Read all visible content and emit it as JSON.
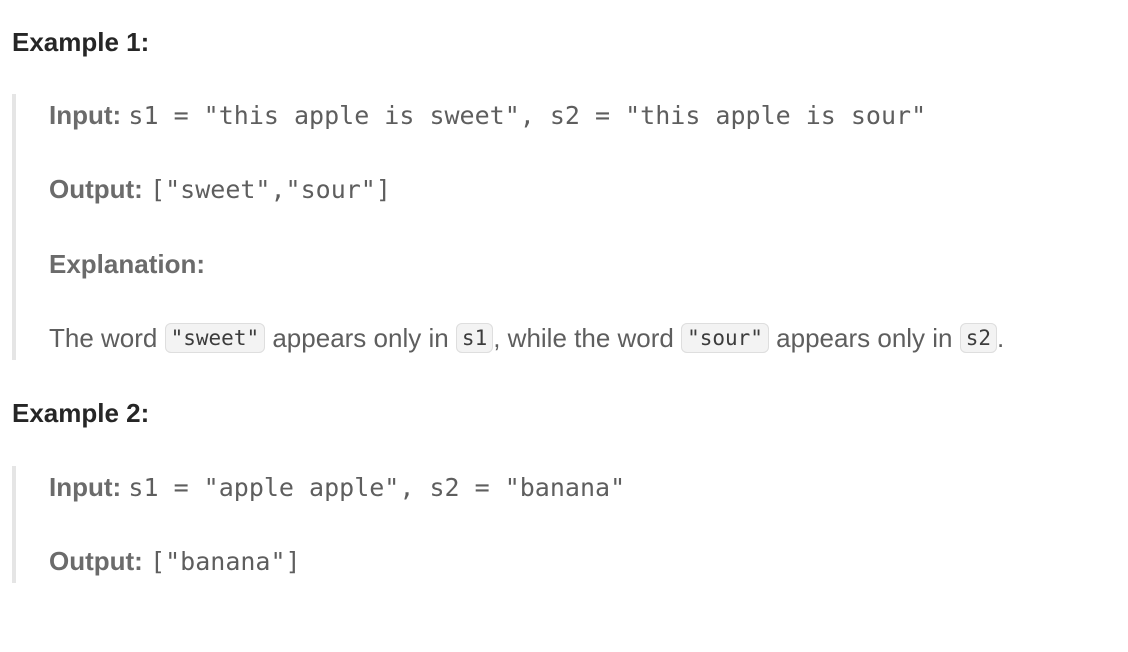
{
  "example1": {
    "heading": "Example 1:",
    "input_label": "Input:",
    "input_value": "s1 = \"this apple is sweet\", s2 = \"this apple is sour\"",
    "output_label": "Output:",
    "output_value": "[\"sweet\",\"sour\"]",
    "explanation_label": "Explanation:",
    "explanation": {
      "t1": "The word ",
      "c1": "\"sweet\"",
      "t2": " appears only in ",
      "c2": "s1",
      "t3": ", while the word ",
      "c3": "\"sour\"",
      "t4": " appears only in ",
      "c4": "s2",
      "t5": "."
    }
  },
  "example2": {
    "heading": "Example 2:",
    "input_label": "Input:",
    "input_value": "s1 = \"apple apple\", s2 = \"banana\"",
    "output_label": "Output:",
    "output_value": "[\"banana\"]"
  }
}
